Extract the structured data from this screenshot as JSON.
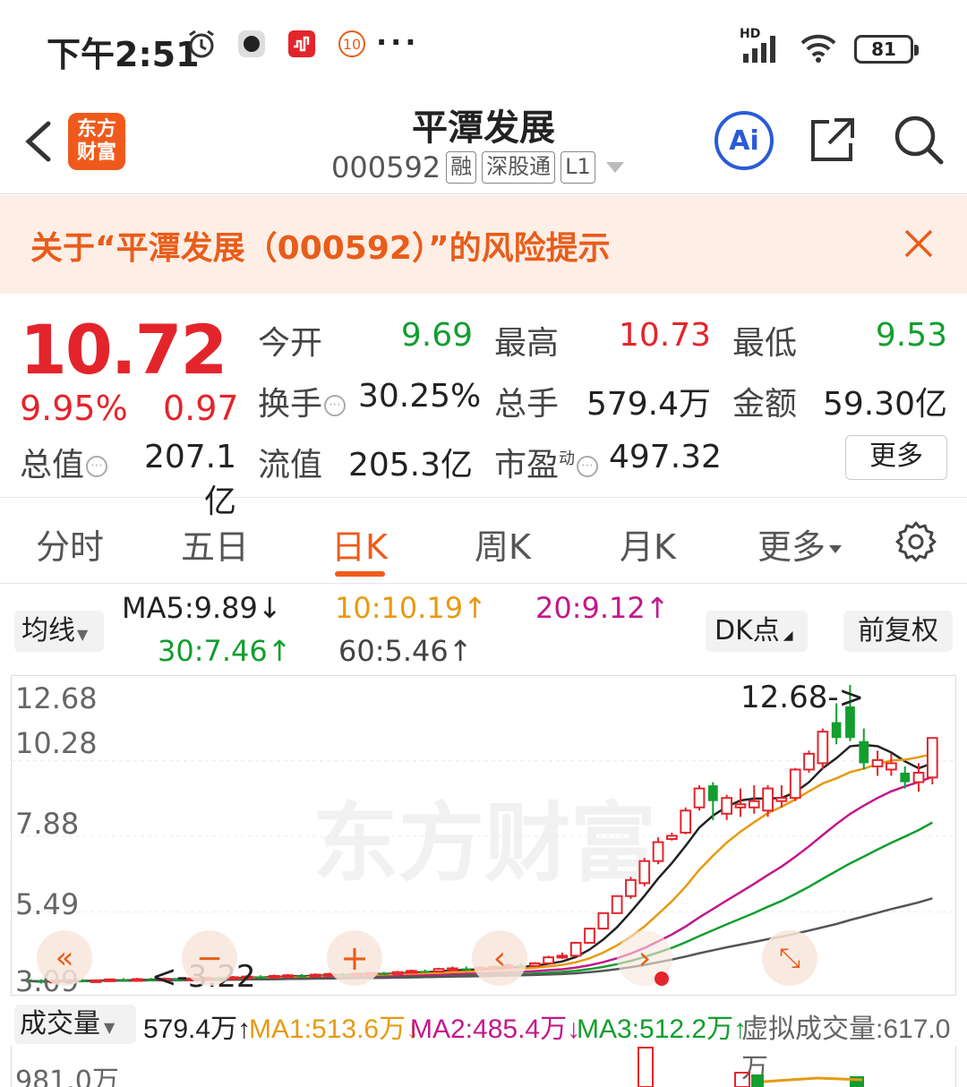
{
  "status": {
    "time": "下午2:51",
    "notif_badge": "10",
    "dots": "···",
    "network": "HD",
    "battery": "81"
  },
  "header": {
    "logo": "东方财富",
    "name": "平潭发展",
    "code": "000592",
    "tags": [
      "融",
      "深股通",
      "L1"
    ],
    "ai": "Ai"
  },
  "risk": {
    "text": "关于“平潭发展（000592）”的风险提示"
  },
  "quote": {
    "price": "10.72",
    "pct": "9.95%",
    "chg": "0.97",
    "open_label": "今开",
    "open": "9.69",
    "high_label": "最高",
    "high": "10.73",
    "low_label": "最低",
    "low": "9.53",
    "turnover_label": "换手",
    "turnover": "30.25%",
    "volume_label": "总手",
    "volume": "579.4万",
    "amount_label": "金额",
    "amount": "59.30亿",
    "mcap_label": "总值",
    "mcap": "207.1亿",
    "float_label": "流值",
    "float": "205.3亿",
    "pe_label": "市盈",
    "pe_sup": "动",
    "pe": "497.32",
    "more": "更多"
  },
  "tabs": [
    {
      "label": "分时"
    },
    {
      "label": "五日"
    },
    {
      "label": "日K"
    },
    {
      "label": "周K"
    },
    {
      "label": "月K"
    },
    {
      "label": "更多"
    }
  ],
  "ma": {
    "select": "均线",
    "ma5": "MA5:9.89↓",
    "ma10": "10:10.19↑",
    "ma20": "20:9.12↑",
    "ma30": "30:7.46↑",
    "ma60": "60:5.46↑",
    "dk": "DK点",
    "fq": "前复权",
    "colors": {
      "ma5": "#222222",
      "ma10": "#e69a12",
      "ma20": "#c2188b",
      "ma30": "#139e2f",
      "ma60": "#555555"
    }
  },
  "chart": {
    "y_labels": [
      "12.68",
      "10.28",
      "7.88",
      "5.49",
      "3.09"
    ],
    "max_label": "12.68->",
    "min_label": "<-3.22",
    "watermark": "东方财富"
  },
  "chart_data": {
    "type": "candlestick",
    "ylim": [
      3.09,
      12.68
    ],
    "candles": [
      {
        "o": 3.35,
        "c": 3.3,
        "h": 3.4,
        "l": 3.25
      },
      {
        "o": 3.3,
        "c": 3.28,
        "h": 3.35,
        "l": 3.22
      },
      {
        "o": 3.28,
        "c": 3.31,
        "h": 3.34,
        "l": 3.24
      },
      {
        "o": 3.31,
        "c": 3.33,
        "h": 3.37,
        "l": 3.27
      },
      {
        "o": 3.33,
        "c": 3.3,
        "h": 3.36,
        "l": 3.27
      },
      {
        "o": 3.3,
        "c": 3.32,
        "h": 3.35,
        "l": 3.26
      },
      {
        "o": 3.32,
        "c": 3.35,
        "h": 3.38,
        "l": 3.29
      },
      {
        "o": 3.35,
        "c": 3.33,
        "h": 3.39,
        "l": 3.29
      },
      {
        "o": 3.33,
        "c": 3.36,
        "h": 3.4,
        "l": 3.3
      },
      {
        "o": 3.36,
        "c": 3.34,
        "h": 3.4,
        "l": 3.3
      },
      {
        "o": 3.34,
        "c": 3.37,
        "h": 3.41,
        "l": 3.31
      },
      {
        "o": 3.37,
        "c": 3.35,
        "h": 3.41,
        "l": 3.31
      },
      {
        "o": 3.35,
        "c": 3.38,
        "h": 3.42,
        "l": 3.32
      },
      {
        "o": 3.38,
        "c": 3.4,
        "h": 3.44,
        "l": 3.34
      },
      {
        "o": 3.4,
        "c": 3.38,
        "h": 3.44,
        "l": 3.34
      },
      {
        "o": 3.38,
        "c": 3.42,
        "h": 3.46,
        "l": 3.35
      },
      {
        "o": 3.42,
        "c": 3.44,
        "h": 3.48,
        "l": 3.38
      },
      {
        "o": 3.44,
        "c": 3.42,
        "h": 3.48,
        "l": 3.38
      },
      {
        "o": 3.42,
        "c": 3.46,
        "h": 3.5,
        "l": 3.4
      },
      {
        "o": 3.46,
        "c": 3.48,
        "h": 3.52,
        "l": 3.42
      },
      {
        "o": 3.48,
        "c": 3.45,
        "h": 3.52,
        "l": 3.42
      },
      {
        "o": 3.45,
        "c": 3.5,
        "h": 3.54,
        "l": 3.43
      },
      {
        "o": 3.5,
        "c": 3.52,
        "h": 3.56,
        "l": 3.47
      },
      {
        "o": 3.52,
        "c": 3.49,
        "h": 3.56,
        "l": 3.46
      },
      {
        "o": 3.49,
        "c": 3.53,
        "h": 3.57,
        "l": 3.47
      },
      {
        "o": 3.53,
        "c": 3.55,
        "h": 3.59,
        "l": 3.5
      },
      {
        "o": 3.55,
        "c": 3.52,
        "h": 3.59,
        "l": 3.49
      },
      {
        "o": 3.52,
        "c": 3.58,
        "h": 3.62,
        "l": 3.5
      },
      {
        "o": 3.58,
        "c": 3.62,
        "h": 3.66,
        "l": 3.55
      },
      {
        "o": 3.62,
        "c": 3.6,
        "h": 3.66,
        "l": 3.56
      },
      {
        "o": 3.6,
        "c": 3.68,
        "h": 3.72,
        "l": 3.58
      },
      {
        "o": 3.68,
        "c": 3.7,
        "h": 3.76,
        "l": 3.64
      },
      {
        "o": 3.7,
        "c": 3.66,
        "h": 3.76,
        "l": 3.62
      },
      {
        "o": 3.66,
        "c": 3.72,
        "h": 3.78,
        "l": 3.64
      },
      {
        "o": 3.72,
        "c": 3.75,
        "h": 3.8,
        "l": 3.68
      },
      {
        "o": 3.75,
        "c": 3.8,
        "h": 3.85,
        "l": 3.72
      },
      {
        "o": 3.8,
        "c": 3.78,
        "h": 3.86,
        "l": 3.74
      },
      {
        "o": 3.78,
        "c": 3.86,
        "h": 3.9,
        "l": 3.76
      },
      {
        "o": 3.86,
        "c": 4.05,
        "h": 4.1,
        "l": 3.84
      },
      {
        "o": 4.05,
        "c": 4.1,
        "h": 4.2,
        "l": 4.0
      },
      {
        "o": 4.1,
        "c": 4.51,
        "h": 4.51,
        "l": 4.08
      },
      {
        "o": 4.51,
        "c": 4.96,
        "h": 4.96,
        "l": 4.5
      },
      {
        "o": 4.96,
        "c": 5.45,
        "h": 5.46,
        "l": 4.95
      },
      {
        "o": 5.45,
        "c": 5.99,
        "h": 6.0,
        "l": 5.44
      },
      {
        "o": 5.99,
        "c": 6.5,
        "h": 6.6,
        "l": 5.9
      },
      {
        "o": 6.4,
        "c": 7.1,
        "h": 7.2,
        "l": 6.3
      },
      {
        "o": 7.1,
        "c": 7.7,
        "h": 7.85,
        "l": 7.0
      },
      {
        "o": 7.8,
        "c": 7.9,
        "h": 8.0,
        "l": 7.75
      },
      {
        "o": 8.0,
        "c": 8.7,
        "h": 8.8,
        "l": 7.95
      },
      {
        "o": 8.8,
        "c": 9.4,
        "h": 9.5,
        "l": 8.7
      },
      {
        "o": 9.5,
        "c": 9.0,
        "h": 9.6,
        "l": 8.4
      },
      {
        "o": 8.6,
        "c": 9.1,
        "h": 9.2,
        "l": 8.4
      },
      {
        "o": 8.8,
        "c": 8.9,
        "h": 9.4,
        "l": 8.5
      },
      {
        "o": 8.8,
        "c": 9.0,
        "h": 9.5,
        "l": 8.6
      },
      {
        "o": 8.7,
        "c": 9.4,
        "h": 9.5,
        "l": 8.5
      },
      {
        "o": 9.0,
        "c": 9.1,
        "h": 9.5,
        "l": 8.8
      },
      {
        "o": 9.1,
        "c": 10.0,
        "h": 10.05,
        "l": 9.0
      },
      {
        "o": 10.0,
        "c": 10.5,
        "h": 10.6,
        "l": 9.9
      },
      {
        "o": 10.2,
        "c": 11.2,
        "h": 11.3,
        "l": 10.0
      },
      {
        "o": 11.5,
        "c": 11.0,
        "h": 12.1,
        "l": 10.8
      },
      {
        "o": 12.0,
        "c": 11.0,
        "h": 12.68,
        "l": 10.9
      },
      {
        "o": 10.9,
        "c": 10.2,
        "h": 11.3,
        "l": 10.0
      },
      {
        "o": 10.1,
        "c": 10.3,
        "h": 10.6,
        "l": 9.8
      },
      {
        "o": 10.0,
        "c": 10.2,
        "h": 10.5,
        "l": 9.8
      },
      {
        "o": 9.9,
        "c": 9.6,
        "h": 10.1,
        "l": 9.4
      },
      {
        "o": 9.6,
        "c": 9.9,
        "h": 10.2,
        "l": 9.3
      },
      {
        "o": 9.75,
        "c": 11.0,
        "h": 11.0,
        "l": 9.53
      }
    ],
    "ma5_tail": [
      3.3,
      3.3,
      3.31,
      3.31,
      3.32,
      3.33,
      3.34,
      3.35,
      3.36,
      3.37,
      3.38,
      3.39,
      3.4,
      3.42,
      3.44,
      3.46,
      3.48,
      3.5,
      3.52,
      3.54,
      3.56,
      3.58,
      3.6,
      3.62,
      3.64,
      3.66,
      3.68,
      3.72,
      3.76,
      3.82,
      3.92,
      4.05,
      4.25,
      4.5,
      4.8,
      5.15,
      5.55,
      6.0,
      6.45,
      6.95,
      7.4,
      7.85,
      8.25,
      8.65,
      9.0,
      9.25,
      9.35,
      9.4,
      9.55,
      9.8,
      10.1,
      10.45,
      10.8,
      11.0,
      11.05,
      10.9,
      10.6,
      10.3,
      10.1,
      10.0,
      9.98
    ],
    "volume": {
      "labels": {
        "top": "981.0万"
      }
    }
  },
  "volume": {
    "select": "成交量",
    "cur": "579.4万↑",
    "ma1": "MA1:513.6万↓",
    "ma2": "MA2:485.4万↓",
    "ma3": "MA3:512.2万↑",
    "virtual": "虚拟成交量:617.0万",
    "top": "981.0万"
  }
}
